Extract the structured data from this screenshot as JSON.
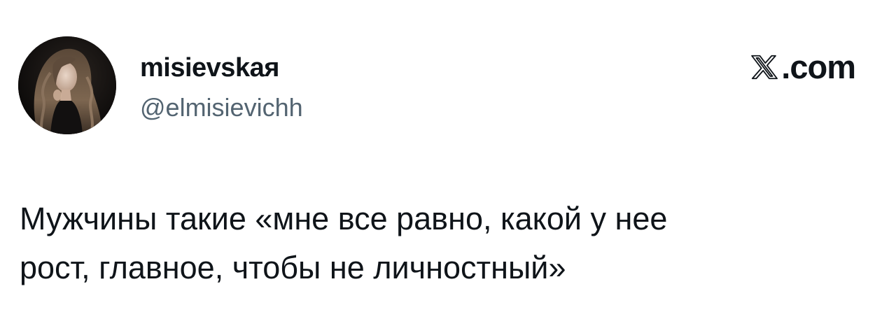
{
  "tweet": {
    "author": {
      "display_name": "misievskaя",
      "handle": "@elmisievichh",
      "avatar_icon": "profile-photo"
    },
    "brand": {
      "icon": "x-logo-icon",
      "suffix": ".com"
    },
    "text_lines": [
      "Мужчины такие «мне все равно, какой у нее",
      "рост, главное, чтобы не личностный»"
    ]
  },
  "colors": {
    "text_primary": "#0f1419",
    "text_secondary": "#536471",
    "background": "#ffffff"
  }
}
